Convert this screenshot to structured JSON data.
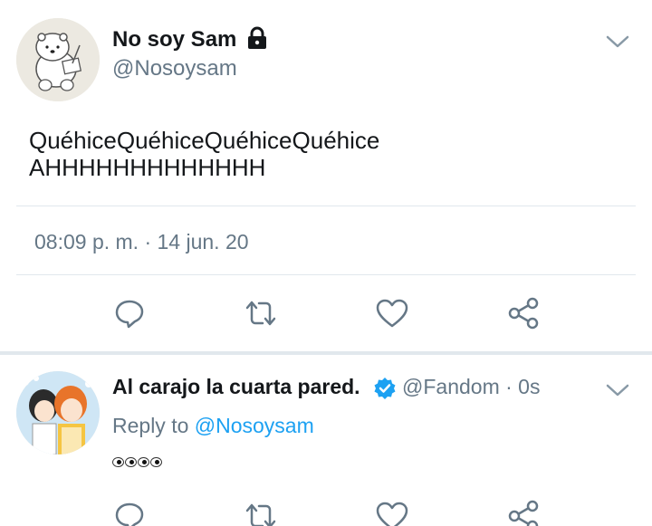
{
  "main_tweet": {
    "display_name": "No soy Sam",
    "handle": "@Nosoysam",
    "protected_icon": "lock-icon",
    "text_line1": "QuéhiceQuéhiceQuéhiceQuéhice",
    "text_line2": "AHHHHHHHHHHHHH",
    "timestamp": "08:09 p. m. · 14 jun. 20",
    "actions": [
      "reply-icon",
      "retweet-icon",
      "like-icon",
      "share-icon"
    ]
  },
  "reply_tweet": {
    "display_name": "Al carajo la cuarta pared.",
    "verified_icon": "verified-badge-icon",
    "handle_time": "@Fandom · 0s",
    "reply_prefix": "Reply to ",
    "reply_mention": "@Nosoysam",
    "text_emoji": "eyes-emoji ×4",
    "actions": [
      "reply-icon",
      "retweet-icon",
      "like-icon",
      "share-icon"
    ]
  },
  "colors": {
    "text_primary": "#14171a",
    "text_secondary": "#657786",
    "link": "#1da1f2",
    "divider": "#e1e8ed",
    "icon": "#657786"
  }
}
